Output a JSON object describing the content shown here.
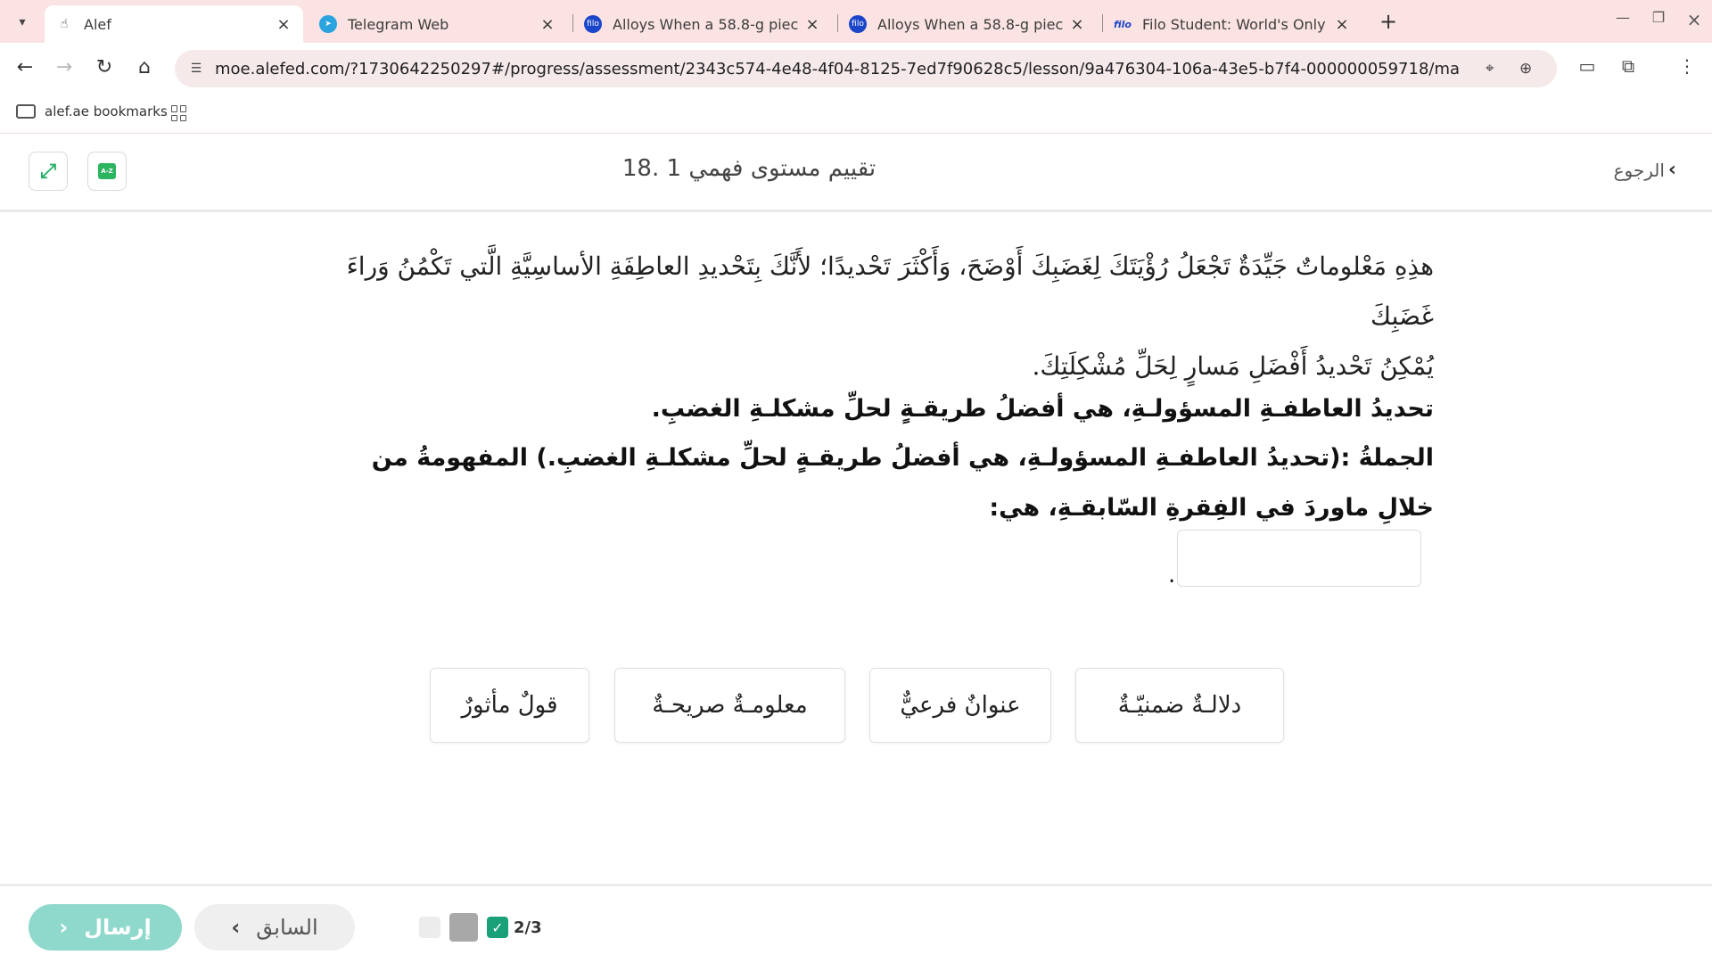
{
  "browser": {
    "tabs": [
      {
        "title": "Alef",
        "active": true,
        "favicon": "touch-hand-icon"
      },
      {
        "title": "Telegram Web",
        "active": false,
        "favicon": "telegram-icon"
      },
      {
        "title": "Alloys When a 58.8-g piece of h",
        "active": false,
        "favicon": "filo-icon"
      },
      {
        "title": "Alloys When a 58.8-g piece of h",
        "active": false,
        "favicon": "filo-icon"
      },
      {
        "title": "Filo Student: World's Only Live I",
        "active": false,
        "favicon": "filo-icon"
      }
    ],
    "url": "moe.alefed.com/?1730642250297#/progress/assessment/2343c574-4e48-4f04-8125-7ed7f90628c5/lesson/9a476304-106a-43e5-b7f4-000000059718/material/cc25b897-19ec-4...",
    "bookmarks": {
      "folder_label": "alef.ae bookmarks"
    },
    "filo_badge": "filo"
  },
  "header": {
    "title": "18. تقييم مستوى فهمي 1",
    "back_label": "الرجوع",
    "dictionary_badge": "A-Z"
  },
  "content": {
    "passage_line1": "هذِهِ مَعْلوماتٌ جَيِّدَةٌ تَجْعَلُ رُؤْيَتَكَ لِغَضَبِكَ أَوْضَحَ، وَأَكْثَرَ تَحْديدًا؛ لأَنَّكَ بِتَحْديدِ العاطِفَةِ الأساسِيَّةِ الَّتي تَكْمُنُ وَراءَ غَضَبِكَ",
    "passage_line2": "يُمْكِنُ تَحْديدُ أَفْضَلِ مَسارٍ لِحَلِّ مُشْكِلَتِكَ.",
    "statement": "تحديدُ العاطفـةِ المسؤولـةِ، هي أفضلُ طريقـةٍ لحلِّ مشكلـةِ الغضبِ.",
    "question": "الجملةُ :(تحديدُ العاطفـةِ المسؤولـةِ، هي أفضلُ طريقـةٍ لحلِّ مشكلـةِ الغضبِ.) المفهومةُ من خلالِ ماوردَ في الفِقرةِ السّابقـةِ، هي:",
    "answer_suffix": "."
  },
  "options": [
    {
      "label": "دلالـةٌ ضمنيّـةٌ"
    },
    {
      "label": "عنوانٌ فرعيٌّ"
    },
    {
      "label": "معلومـةٌ صريحـةٌ"
    },
    {
      "label": "قولٌ مأثورٌ"
    }
  ],
  "footer": {
    "submit_label": "إرسال",
    "previous_label": "السابق",
    "progress_text": "2/3"
  },
  "colors": {
    "accent_green": "#1aa17a",
    "submit_button": "#8fd8cc",
    "tabstrip": "#fbe3e3"
  }
}
